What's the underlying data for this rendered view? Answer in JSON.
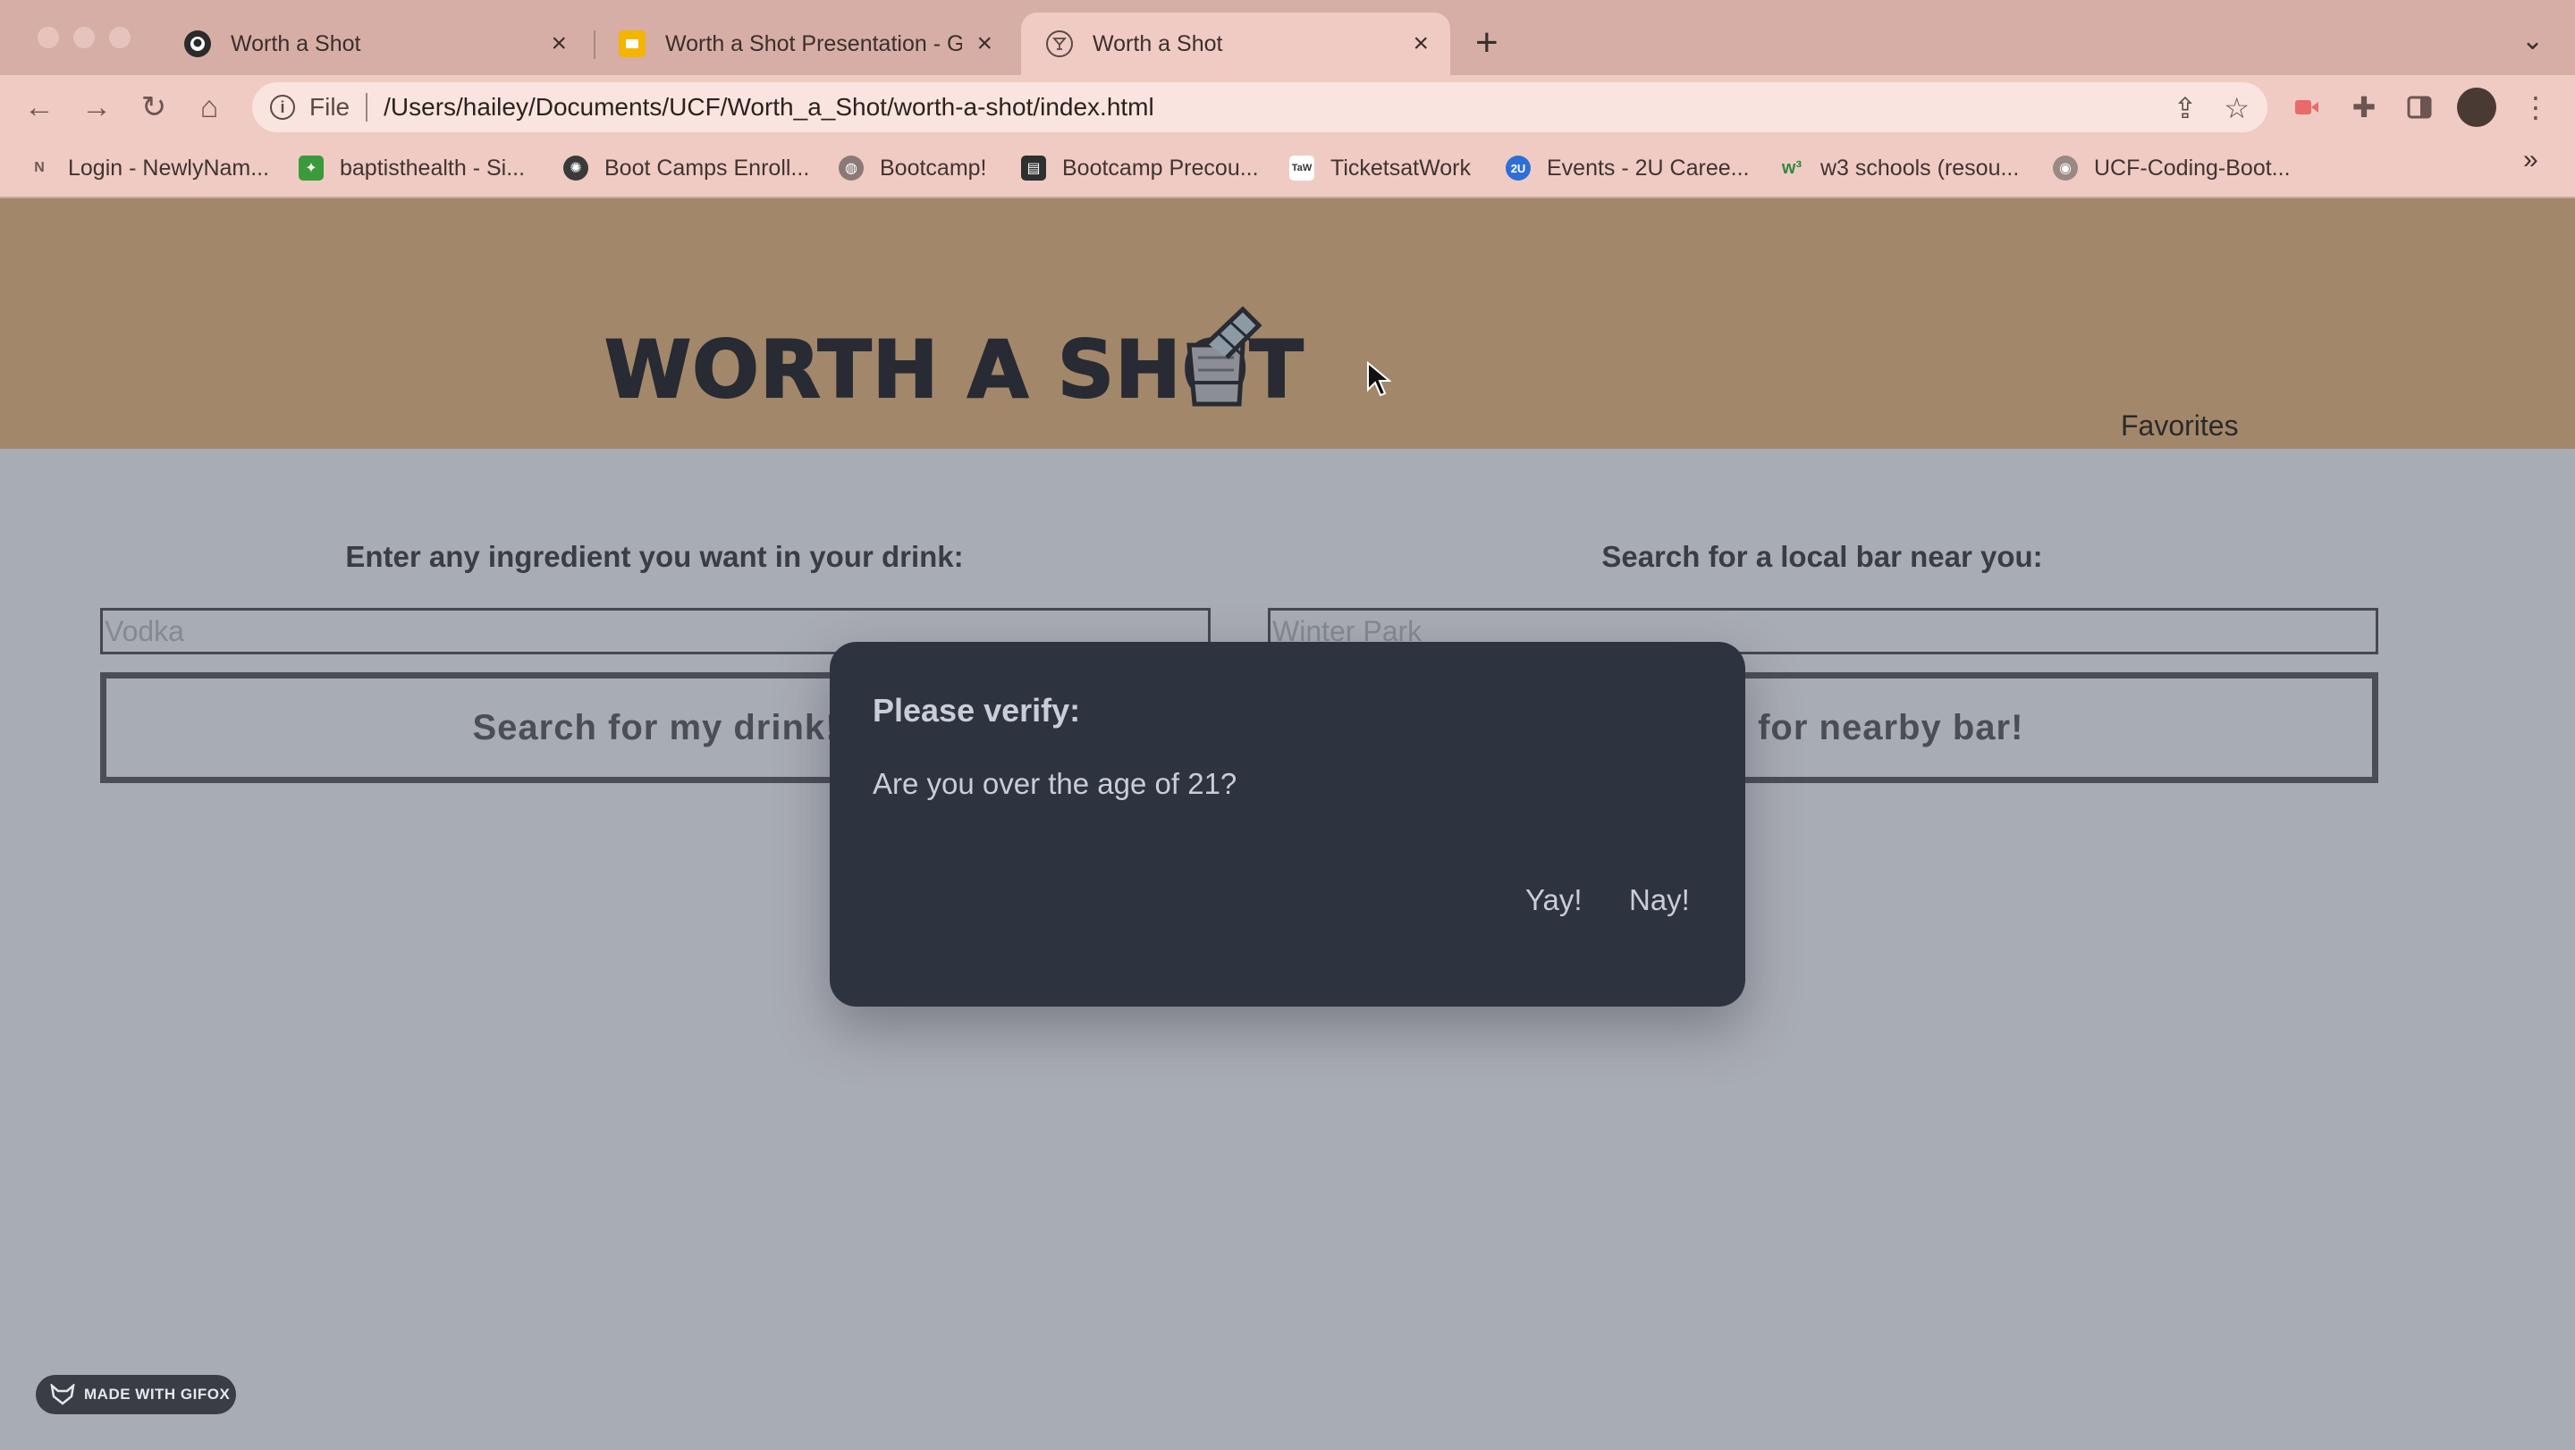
{
  "browser": {
    "tabs": [
      {
        "title": "Worth a Shot",
        "icon": "github-icon",
        "active": false
      },
      {
        "title": "Worth a Shot Presentation - Go",
        "icon": "slides-icon",
        "active": false
      },
      {
        "title": "Worth a Shot",
        "icon": "cocktail-icon",
        "active": true
      }
    ],
    "address": {
      "scheme": "File",
      "url": "/Users/hailey/Documents/UCF/Worth_a_Shot/worth-a-shot/index.html"
    },
    "bookmarks": [
      {
        "label": "Login - NewlyNam...",
        "icon": "newlynamed-icon"
      },
      {
        "label": "baptisthealth - Si...",
        "icon": "pineapple-icon"
      },
      {
        "label": "Boot Camps Enroll...",
        "icon": "ucf-icon"
      },
      {
        "label": "Bootcamp!",
        "icon": "globe-icon"
      },
      {
        "label": "Bootcamp Precou...",
        "icon": "book-icon"
      },
      {
        "label": "TicketsatWork",
        "icon": "taw-icon"
      },
      {
        "label": "Events - 2U Caree...",
        "icon": "2u-icon"
      },
      {
        "label": "w3 schools (resou...",
        "icon": "w3-icon"
      },
      {
        "label": "UCF-Coding-Boot...",
        "icon": "github-icon"
      }
    ]
  },
  "header": {
    "logo_text": "WORTH A SHOT",
    "favorites_label": "Favorites"
  },
  "drink_search": {
    "label": "Enter any ingredient you want in your drink:",
    "placeholder": "Vodka",
    "button_label": "Search for my drink!"
  },
  "bar_search": {
    "label": "Search for a local bar near you:",
    "placeholder": "Winter Park",
    "button_label": "Search for nearby bar!"
  },
  "modal": {
    "title": "Please verify:",
    "body": "Are you over the age of 21?",
    "yes_label": "Yay!",
    "no_label": "Nay!"
  },
  "badge": {
    "label": "MADE WITH GIFOX"
  },
  "colors": {
    "chrome_tabstrip": "#d7aea5",
    "chrome_toolbar": "#f0cbc3",
    "header_bg": "#a2876a",
    "page_bg": "#a8acb3",
    "modal_bg": "#2e3340"
  }
}
